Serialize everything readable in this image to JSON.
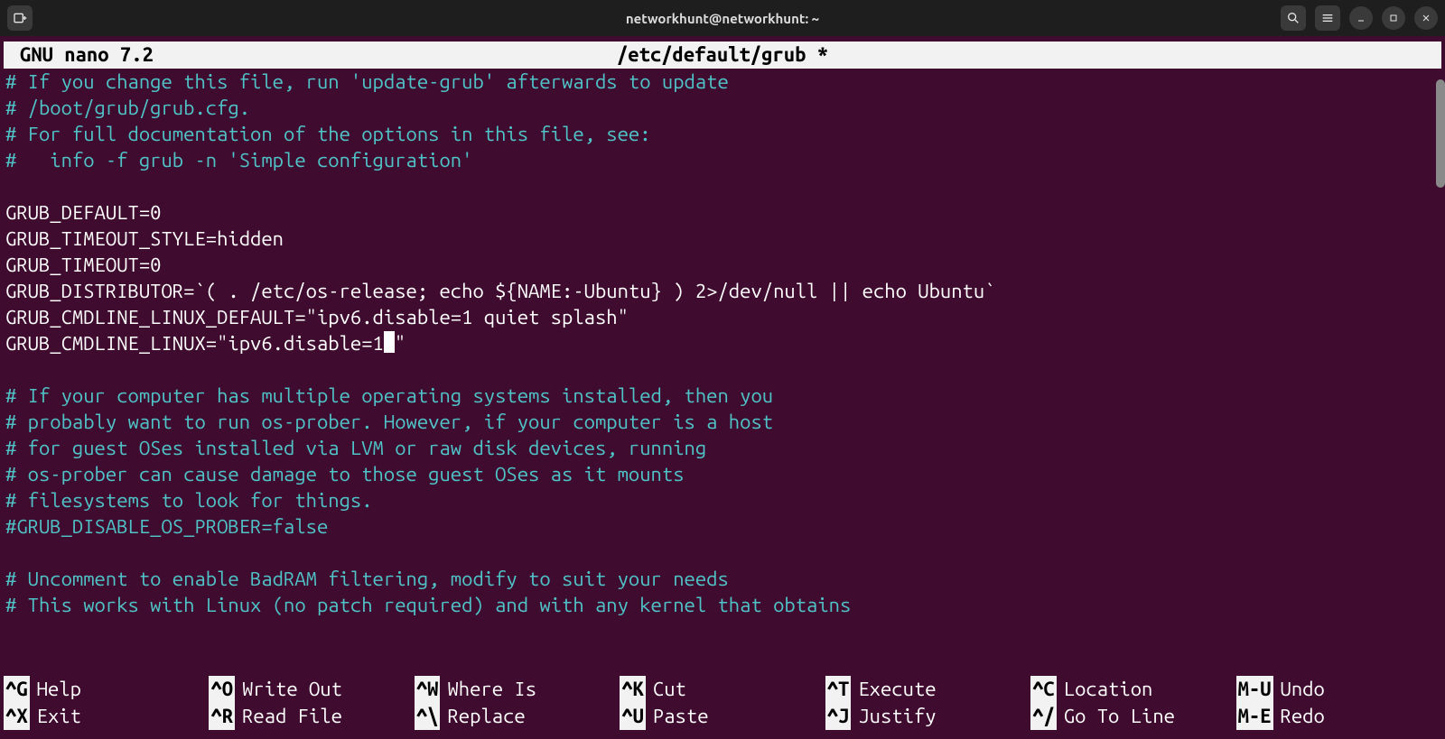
{
  "titlebar": {
    "title": "networkhunt@networkhunt: ~"
  },
  "nano": {
    "app": "GNU nano 7.2",
    "filename": "/etc/default/grub *"
  },
  "lines": [
    {
      "t": "comment",
      "text": "# If you change this file, run 'update-grub' afterwards to update"
    },
    {
      "t": "comment",
      "text": "# /boot/grub/grub.cfg."
    },
    {
      "t": "comment",
      "text": "# For full documentation of the options in this file, see:"
    },
    {
      "t": "comment",
      "text": "#   info -f grub -n 'Simple configuration'"
    },
    {
      "t": "plain",
      "text": ""
    },
    {
      "t": "plain",
      "text": "GRUB_DEFAULT=0"
    },
    {
      "t": "plain",
      "text": "GRUB_TIMEOUT_STYLE=hidden"
    },
    {
      "t": "plain",
      "text": "GRUB_TIMEOUT=0"
    },
    {
      "t": "plain",
      "text": "GRUB_DISTRIBUTOR=`( . /etc/os-release; echo ${NAME:-Ubuntu} ) 2>/dev/null || echo Ubuntu`"
    },
    {
      "t": "plain",
      "text": "GRUB_CMDLINE_LINUX_DEFAULT=\"ipv6.disable=1 quiet splash\""
    },
    {
      "t": "cursor",
      "text": "GRUB_CMDLINE_LINUX=\"ipv6.disable=1",
      "after": "\""
    },
    {
      "t": "plain",
      "text": ""
    },
    {
      "t": "comment",
      "text": "# If your computer has multiple operating systems installed, then you"
    },
    {
      "t": "comment",
      "text": "# probably want to run os-prober. However, if your computer is a host"
    },
    {
      "t": "comment",
      "text": "# for guest OSes installed via LVM or raw disk devices, running"
    },
    {
      "t": "comment",
      "text": "# os-prober can cause damage to those guest OSes as it mounts"
    },
    {
      "t": "comment",
      "text": "# filesystems to look for things."
    },
    {
      "t": "comment",
      "text": "#GRUB_DISABLE_OS_PROBER=false"
    },
    {
      "t": "plain",
      "text": ""
    },
    {
      "t": "comment",
      "text": "# Uncomment to enable BadRAM filtering, modify to suit your needs"
    },
    {
      "t": "comment",
      "text": "# This works with Linux (no patch required) and with any kernel that obtains"
    }
  ],
  "shortcuts": [
    [
      {
        "key": "^G",
        "label": "Help"
      },
      {
        "key": "^O",
        "label": "Write Out"
      },
      {
        "key": "^W",
        "label": "Where Is"
      },
      {
        "key": "^K",
        "label": "Cut"
      },
      {
        "key": "^T",
        "label": "Execute"
      },
      {
        "key": "^C",
        "label": "Location"
      },
      {
        "key": "M-U",
        "label": "Undo"
      }
    ],
    [
      {
        "key": "^X",
        "label": "Exit"
      },
      {
        "key": "^R",
        "label": "Read File"
      },
      {
        "key": "^\\",
        "label": "Replace"
      },
      {
        "key": "^U",
        "label": "Paste"
      },
      {
        "key": "^J",
        "label": "Justify"
      },
      {
        "key": "^/",
        "label": "Go To Line"
      },
      {
        "key": "M-E",
        "label": "Redo"
      }
    ]
  ]
}
